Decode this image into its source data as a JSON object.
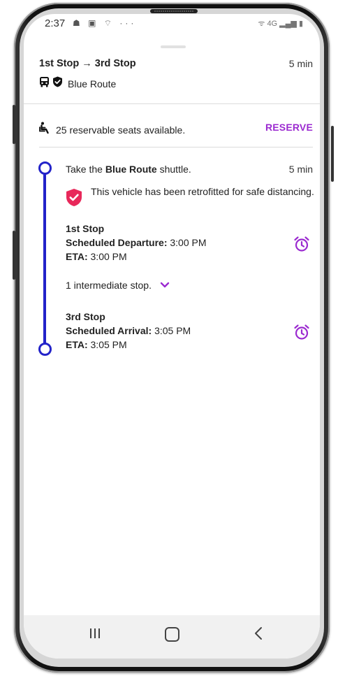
{
  "status_bar": {
    "time": "2:37",
    "left_icons": "☗ ▣ ⌔ ···",
    "right_icons": "ᯤ 4G ▂▄▆ ▮"
  },
  "header": {
    "title": "1st Stop → 3rd Stop",
    "duration": "5 min",
    "route_name": "Blue Route"
  },
  "seats": {
    "text": "25 reservable seats available.",
    "reserve_label": "RESERVE"
  },
  "step": {
    "prefix": "Take the ",
    "route": "Blue Route",
    "suffix": " shuttle.",
    "duration": "5 min",
    "safety_notice": "This vehicle has been retrofitted for safe distancing."
  },
  "origin_stop": {
    "name": "1st Stop",
    "scheduled_label": "Scheduled Departure:",
    "scheduled_time": "3:00 PM",
    "eta_label": "ETA:",
    "eta_time": "3:00 PM"
  },
  "intermediate": {
    "text": "1 intermediate stop."
  },
  "destination_stop": {
    "name": "3rd Stop",
    "scheduled_label": "Scheduled Arrival:",
    "scheduled_time": "3:05 PM",
    "eta_label": "ETA:",
    "eta_time": "3:05 PM"
  },
  "colors": {
    "accent": "#9b2ad0",
    "timeline": "#2323c9",
    "shield": "#e8285a"
  }
}
